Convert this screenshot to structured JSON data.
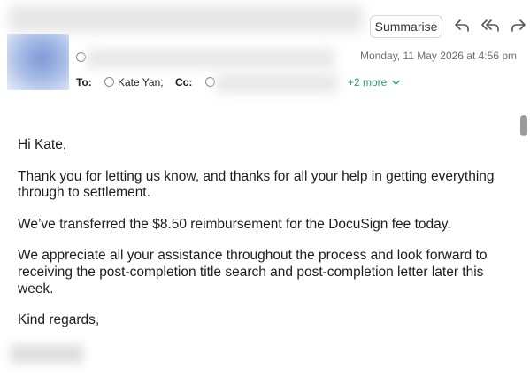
{
  "toolbar": {
    "summarise_label": "Summarise",
    "reply_icon": "reply-icon",
    "reply_all_icon": "reply-all-icon",
    "forward_icon": "forward-icon"
  },
  "header": {
    "date": "Monday, 11 May 2026 at 4:56 pm",
    "to_label": "To:",
    "to_value": "Kate Yan;",
    "cc_label": "Cc:",
    "more_recipients": "+2 more"
  },
  "message": {
    "greeting": "Hi Kate,",
    "paragraph_1": "Thank you for letting us know, and thanks for all your help in getting everything through to settlement.",
    "paragraph_2": "We’ve transferred the $8.50 reimbursement for the DocuSign fee today.",
    "paragraph_3": "We appreciate all your assistance throughout the process and look forward to receiving the post-completion title search and post-completion letter later this week.",
    "closing": "Kind regards,"
  },
  "colors": {
    "link_green": "#2e9e6a",
    "muted_text": "#6e6e73"
  }
}
